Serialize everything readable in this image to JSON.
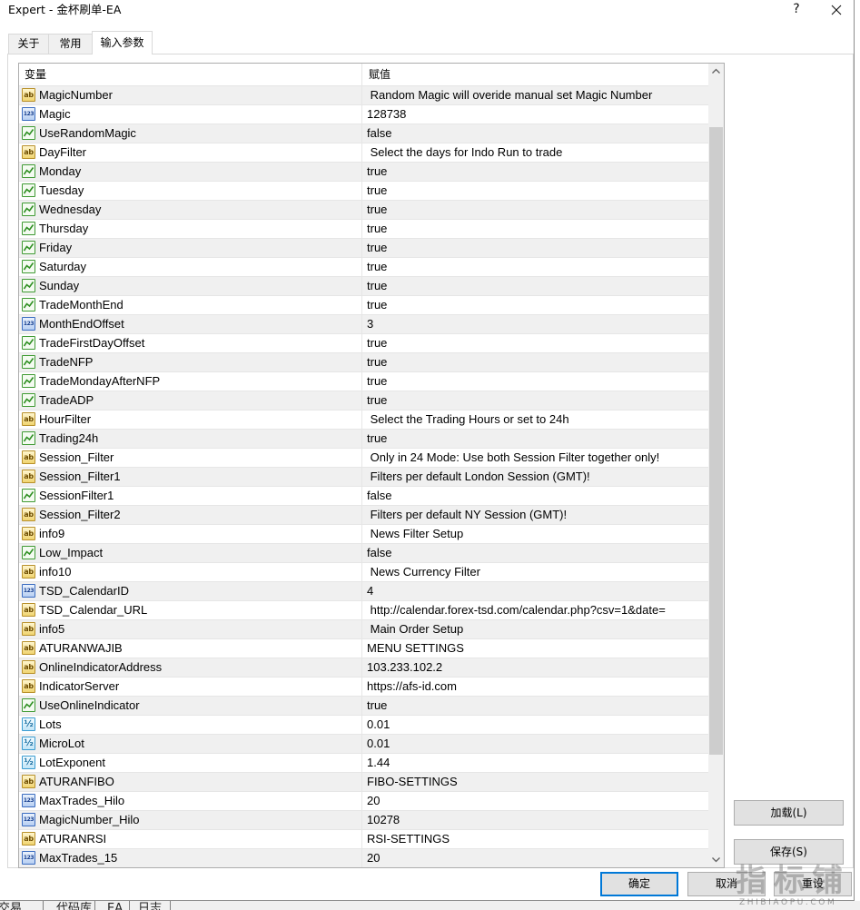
{
  "window": {
    "title": "Expert - 金杯刷单-EA",
    "help_label": "?",
    "close_icon": "close-icon"
  },
  "tabs": [
    {
      "label": "关于",
      "active": false
    },
    {
      "label": "常用",
      "active": false
    },
    {
      "label": "输入参数",
      "active": true
    }
  ],
  "params": {
    "columns": {
      "variable": "变量",
      "value": "赋值"
    },
    "rows": [
      {
        "icon": "string-icon",
        "name": "MagicNumber",
        "value": " Random Magic will overide manual set Magic Number"
      },
      {
        "icon": "integer-icon",
        "name": "Magic",
        "value": "128738"
      },
      {
        "icon": "boolean-icon",
        "name": "UseRandomMagic",
        "value": "false"
      },
      {
        "icon": "string-icon",
        "name": "DayFilter",
        "value": " Select the days for Indo Run to trade"
      },
      {
        "icon": "boolean-icon",
        "name": "Monday",
        "value": "true"
      },
      {
        "icon": "boolean-icon",
        "name": "Tuesday",
        "value": "true"
      },
      {
        "icon": "boolean-icon",
        "name": "Wednesday",
        "value": "true"
      },
      {
        "icon": "boolean-icon",
        "name": "Thursday",
        "value": "true"
      },
      {
        "icon": "boolean-icon",
        "name": "Friday",
        "value": "true"
      },
      {
        "icon": "boolean-icon",
        "name": "Saturday",
        "value": "true"
      },
      {
        "icon": "boolean-icon",
        "name": "Sunday",
        "value": "true"
      },
      {
        "icon": "boolean-icon",
        "name": "TradeMonthEnd",
        "value": "true"
      },
      {
        "icon": "integer-icon",
        "name": "MonthEndOffset",
        "value": "3"
      },
      {
        "icon": "boolean-icon",
        "name": "TradeFirstDayOffset",
        "value": "true"
      },
      {
        "icon": "boolean-icon",
        "name": "TradeNFP",
        "value": "true"
      },
      {
        "icon": "boolean-icon",
        "name": "TradeMondayAfterNFP",
        "value": "true"
      },
      {
        "icon": "boolean-icon",
        "name": "TradeADP",
        "value": "true"
      },
      {
        "icon": "string-icon",
        "name": "HourFilter",
        "value": " Select the Trading Hours or set to 24h"
      },
      {
        "icon": "boolean-icon",
        "name": "Trading24h",
        "value": "true"
      },
      {
        "icon": "string-icon",
        "name": "Session_Filter",
        "value": " Only in 24 Mode: Use both Session Filter together only!"
      },
      {
        "icon": "string-icon",
        "name": "Session_Filter1",
        "value": " Filters per default London Session (GMT)!"
      },
      {
        "icon": "boolean-icon",
        "name": "SessionFilter1",
        "value": "false"
      },
      {
        "icon": "string-icon",
        "name": "Session_Filter2",
        "value": " Filters per default NY Session (GMT)!"
      },
      {
        "icon": "string-icon",
        "name": "info9",
        "value": " News Filter Setup"
      },
      {
        "icon": "boolean-icon",
        "name": "Low_Impact",
        "value": "false"
      },
      {
        "icon": "string-icon",
        "name": "info10",
        "value": " News Currency Filter"
      },
      {
        "icon": "integer-icon",
        "name": "TSD_CalendarID",
        "value": "4"
      },
      {
        "icon": "string-icon",
        "name": "TSD_Calendar_URL",
        "value": " http://calendar.forex-tsd.com/calendar.php?csv=1&date="
      },
      {
        "icon": "string-icon",
        "name": "info5",
        "value": " Main Order Setup"
      },
      {
        "icon": "string-icon",
        "name": "ATURANWAJIB",
        "value": "MENU SETTINGS"
      },
      {
        "icon": "string-icon",
        "name": "OnlineIndicatorAddress",
        "value": "103.233.102.2"
      },
      {
        "icon": "string-icon",
        "name": "IndicatorServer",
        "value": "https://afs-id.com"
      },
      {
        "icon": "boolean-icon",
        "name": "UseOnlineIndicator",
        "value": "true"
      },
      {
        "icon": "double-icon",
        "name": "Lots",
        "value": "0.01"
      },
      {
        "icon": "double-icon",
        "name": "MicroLot",
        "value": "0.01"
      },
      {
        "icon": "double-icon",
        "name": "LotExponent",
        "value": "1.44"
      },
      {
        "icon": "string-icon",
        "name": "ATURANFIBO",
        "value": "FIBO-SETTINGS"
      },
      {
        "icon": "integer-icon",
        "name": "MaxTrades_Hilo",
        "value": "20"
      },
      {
        "icon": "integer-icon",
        "name": "MagicNumber_Hilo",
        "value": "10278"
      },
      {
        "icon": "string-icon",
        "name": "ATURANRSI",
        "value": "RSI-SETTINGS"
      },
      {
        "icon": "integer-icon",
        "name": "MaxTrades_15",
        "value": "20"
      }
    ]
  },
  "side_buttons": {
    "load_label": "加载(L)",
    "save_label": "保存(S)"
  },
  "dialog_buttons": {
    "ok_label": "确定",
    "cancel_label": "取消",
    "reset_label": "重设"
  },
  "background_tabs": [
    "交易",
    "代码库",
    "EA",
    "日志"
  ],
  "watermark": {
    "logo": "指标铺",
    "site": "ZHIBIAOPU.COM"
  },
  "colors": {
    "accent": "#0078d7",
    "boolean_icon": "#2f8f22",
    "integer_icon": "#3a6cc0",
    "string_icon": "#b8902a"
  }
}
